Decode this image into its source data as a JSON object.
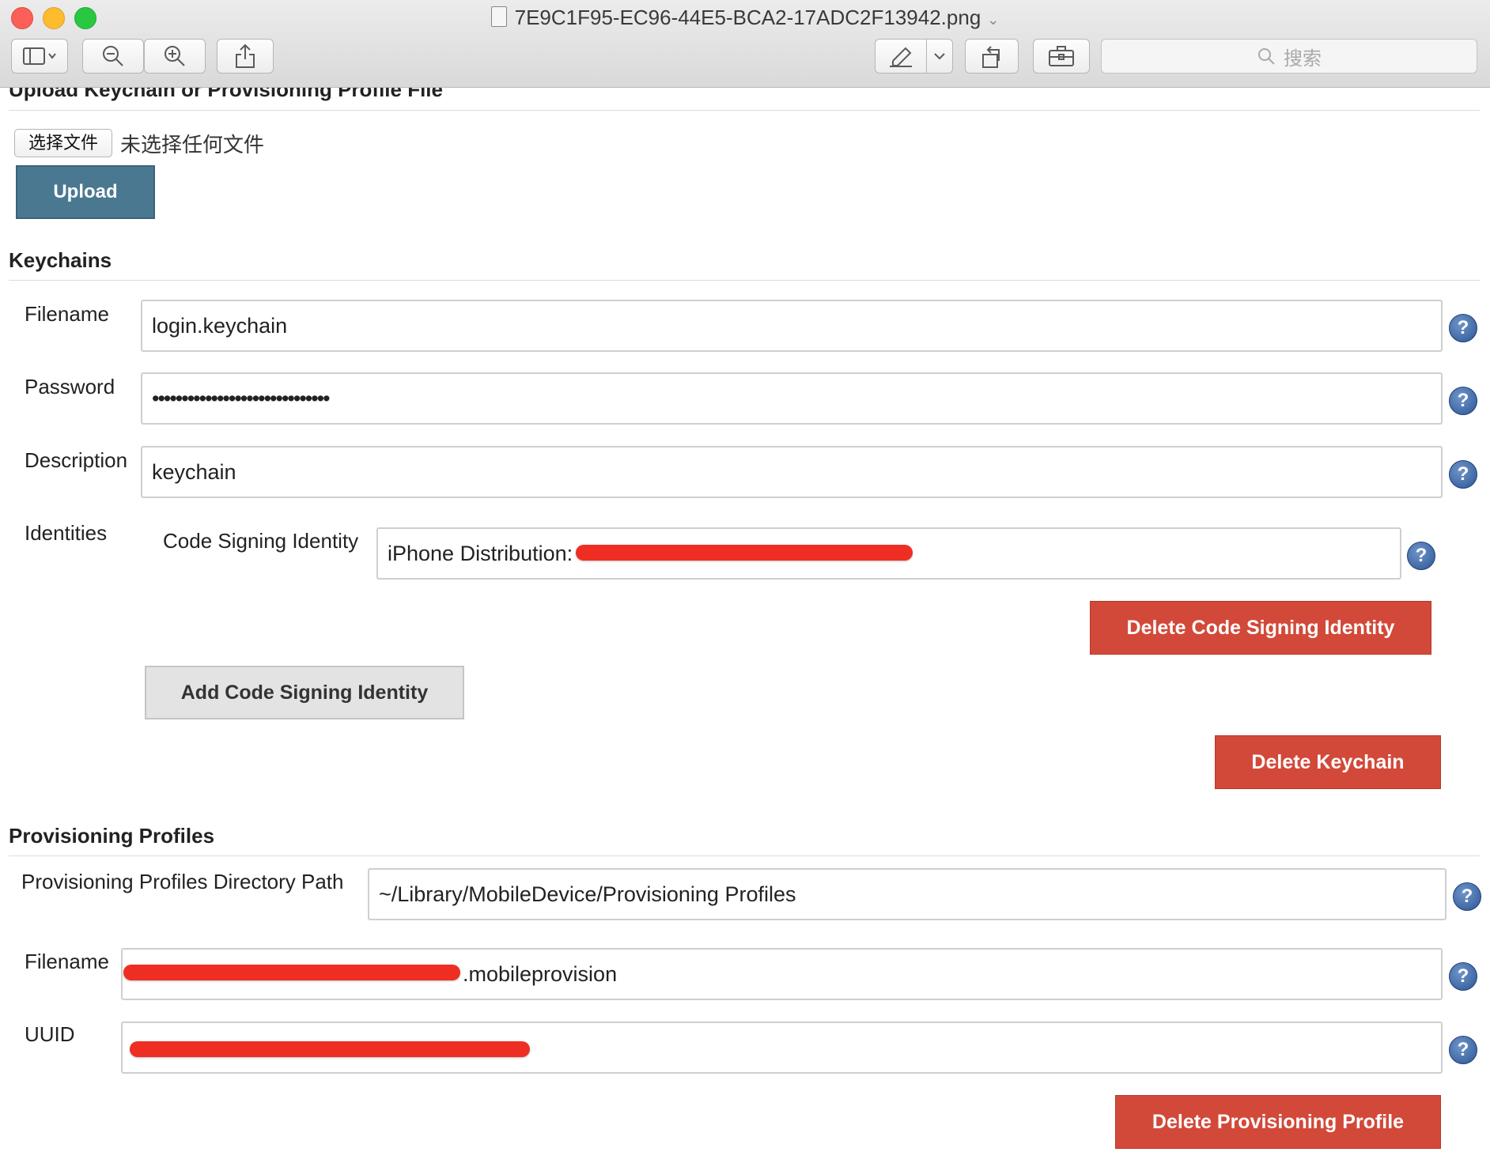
{
  "window": {
    "title": "7E9C1F95-EC96-44E5-BCA2-17ADC2F13942.png",
    "search_placeholder": "搜索"
  },
  "upload": {
    "section_title": "Upload Keychain or Provisioning Profile File",
    "choose_file_label": "选择文件",
    "no_file_text": "未选择任何文件",
    "upload_button": "Upload"
  },
  "keychains": {
    "section_title": "Keychains",
    "filename_label": "Filename",
    "filename_value": "login.keychain",
    "password_label": "Password",
    "password_value": "••••••••••••••••••••••••••••••",
    "description_label": "Description",
    "description_value": "keychain",
    "identities_label": "Identities",
    "code_signing_label": "Code Signing Identity",
    "code_signing_value": "iPhone Distribution:",
    "delete_identity_button": "Delete Code Signing Identity",
    "add_identity_button": "Add Code Signing Identity",
    "delete_keychain_button": "Delete Keychain"
  },
  "profiles": {
    "section_title": "Provisioning Profiles",
    "dir_label": "Provisioning Profiles Directory Path",
    "dir_value": "~/Library/MobileDevice/Provisioning Profiles",
    "filename_label": "Filename",
    "filename_value": ".mobileprovision",
    "uuid_label": "UUID",
    "uuid_value": "",
    "delete_profile_button": "Delete Provisioning Profile"
  },
  "help_glyph": "?",
  "colors": {
    "danger": "#d24939",
    "upload": "#4a7890",
    "help": "#2c5596",
    "redaction": "#ef2e23"
  }
}
